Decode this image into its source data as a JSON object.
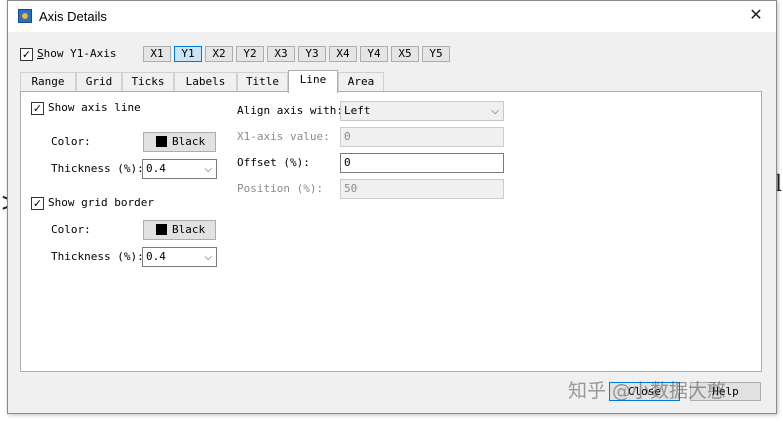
{
  "dialog": {
    "title": "Axis Details",
    "close_glyph": "✕"
  },
  "show_axis": {
    "label": "Show Y1-Axis",
    "checked": true
  },
  "axis_buttons": [
    {
      "label": "X1",
      "active": false
    },
    {
      "label": "Y1",
      "active": true
    },
    {
      "label": "X2",
      "active": false
    },
    {
      "label": "Y2",
      "active": false
    },
    {
      "label": "X3",
      "active": false
    },
    {
      "label": "Y3",
      "active": false
    },
    {
      "label": "X4",
      "active": false
    },
    {
      "label": "Y4",
      "active": false
    },
    {
      "label": "X5",
      "active": false
    },
    {
      "label": "Y5",
      "active": false
    }
  ],
  "tabs": [
    {
      "label": "Range",
      "active": false
    },
    {
      "label": "Grid",
      "active": false
    },
    {
      "label": "Ticks",
      "active": false
    },
    {
      "label": "Labels",
      "active": false
    },
    {
      "label": "Title",
      "active": false
    },
    {
      "label": "Line",
      "active": true
    },
    {
      "label": "Area",
      "active": false
    }
  ],
  "line_tab": {
    "show_axis_line": {
      "label": "Show axis line",
      "checked": true
    },
    "axis_color": {
      "label": "Color:",
      "value": "Black",
      "swatch": "#000000"
    },
    "axis_thickness": {
      "label": "Thickness (%):",
      "value": "0.4"
    },
    "show_grid_border": {
      "label": "Show grid border",
      "checked": true
    },
    "grid_color": {
      "label": "Color:",
      "value": "Black",
      "swatch": "#000000"
    },
    "grid_thickness": {
      "label": "Thickness (%):",
      "value": "0.4"
    },
    "align_axis": {
      "label": "Align axis with:",
      "value": "Left"
    },
    "x1_axis_value": {
      "label": "X1-axis value:",
      "value": "0"
    },
    "offset": {
      "label": "Offset (%):",
      "value": "0"
    },
    "position": {
      "label": "Position (%):",
      "value": "50"
    }
  },
  "footer": {
    "close_label": "Close",
    "help_label": "Help"
  },
  "watermark": "知乎 @小数据大憨",
  "colors": {
    "accent": "#0078d7",
    "active_button_bg": "#cce4f7",
    "dialog_bg": "#f0f0f0"
  }
}
